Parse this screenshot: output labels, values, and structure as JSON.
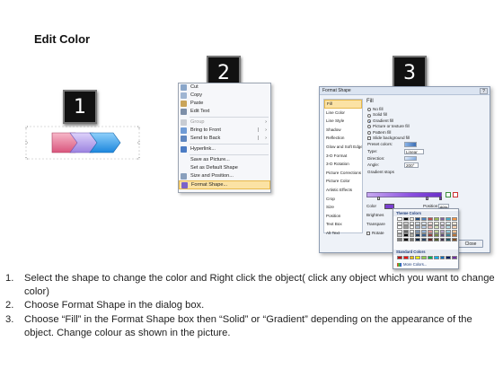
{
  "slide": {
    "title": "Edit Color",
    "badges": [
      "1",
      "2",
      "3"
    ]
  },
  "colors": {
    "shape_left": "#e87a9a",
    "shape_mid": "#b7a3ee",
    "shape_right": "#3aa4ee",
    "highlight": "#fbe2a4",
    "gradient_fill": "#8a4fe0"
  },
  "context_menu": {
    "items": [
      {
        "label": "Cut",
        "icon": "scissors-icon",
        "accel": "t"
      },
      {
        "label": "Copy",
        "icon": "copy-icon",
        "accel": "C"
      },
      {
        "label": "Paste",
        "icon": "paste-icon",
        "accel": "P"
      },
      {
        "label": "Edit Text",
        "icon": "edit-text-icon",
        "accel": "x"
      },
      {
        "label": "Group",
        "icon": "group-icon",
        "accel": "G",
        "disabled": true,
        "submenu": true
      },
      {
        "label": "Bring to Front",
        "icon": "bring-front-icon",
        "accel": "r",
        "submenu": true,
        "split": true
      },
      {
        "label": "Send to Back",
        "icon": "send-back-icon",
        "accel": "k",
        "submenu": true,
        "split": true
      },
      {
        "label": "Hyperlink...",
        "icon": "hyperlink-icon",
        "accel": "H"
      },
      {
        "label": "Save as Picture...",
        "icon": "",
        "accel": "S"
      },
      {
        "label": "Set as Default Shape",
        "icon": "",
        "accel": "D"
      },
      {
        "label": "Size and Position...",
        "icon": "size-icon",
        "accel": "z"
      },
      {
        "label": "Format Shape...",
        "icon": "format-shape-icon",
        "accel": "o",
        "highlighted": true
      }
    ]
  },
  "format_dialog": {
    "title": "Format Shape",
    "close_x": "?",
    "nav": [
      "Fill",
      "Line Color",
      "Line Style",
      "Shadow",
      "Reflection",
      "Glow and Soft Edges",
      "3-D Format",
      "3-D Rotation",
      "Picture Corrections",
      "Picture Color",
      "Artistic Effects",
      "Crop",
      "Size",
      "Position",
      "Text Box",
      "Alt Text"
    ],
    "selected_nav": "Fill",
    "heading": "Fill",
    "fill_options": [
      {
        "label": "No fill",
        "type": "radio",
        "checked": false
      },
      {
        "label": "Solid fill",
        "type": "radio",
        "checked": false
      },
      {
        "label": "Gradient fill",
        "type": "radio",
        "checked": true
      },
      {
        "label": "Picture or texture fill",
        "type": "radio",
        "checked": false
      },
      {
        "label": "Pattern fill",
        "type": "radio",
        "checked": false
      },
      {
        "label": "Slide background fill",
        "type": "radio",
        "checked": false
      }
    ],
    "preset_label": "Preset colors:",
    "type_label": "Type:",
    "type_value": "Linear",
    "direction_label": "Direction:",
    "angle_label": "Angle:",
    "angle_value": "200°",
    "stops_label": "Gradient stops",
    "color_label": "Color",
    "position_label": "Position:",
    "position_value": "80%",
    "brightness_label": "Brightnes",
    "transparency_label": "Transpare",
    "rotate_label": "Rotate",
    "close_button": "Close"
  },
  "color_picker": {
    "theme_label": "Theme Colors",
    "standard_label": "Standard Colors",
    "more_label": "More Colors...",
    "theme_top": [
      "#ffffff",
      "#000000",
      "#eeece1",
      "#1f497d",
      "#4f81bd",
      "#c0504d",
      "#9bbb59",
      "#8064a2",
      "#4bacc6",
      "#f79646"
    ],
    "standard": [
      "#c00000",
      "#ff0000",
      "#ffc000",
      "#ffff00",
      "#92d050",
      "#00b050",
      "#00b0f0",
      "#0070c0",
      "#002060",
      "#7030a0"
    ]
  },
  "instructions": [
    {
      "num": "1.",
      "text": "Select the shape to change the color and Right click the object( click any object which you want to change color)"
    },
    {
      "num": "2.",
      "text": "Choose Format Shape in the dialog box."
    },
    {
      "num": "3.",
      "text": "Choose “Fill” in the Format Shape box then “Solid” or “Gradient” depending on the appearance of the object. Change colour as shown in the picture."
    }
  ]
}
